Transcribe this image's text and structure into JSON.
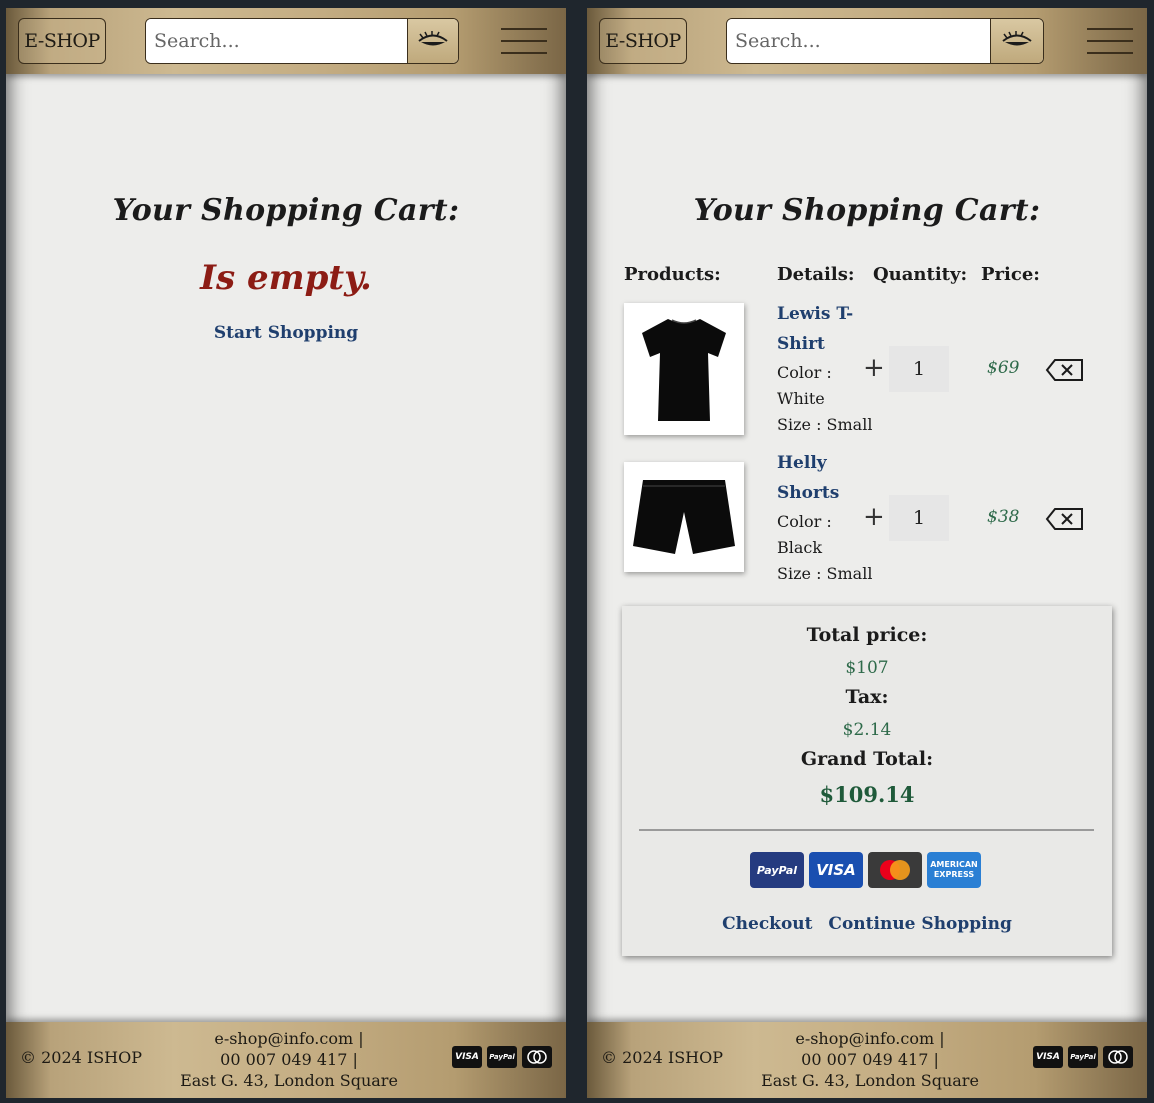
{
  "header": {
    "logo": "E-SHOP",
    "search_placeholder": "Search..."
  },
  "empty_view": {
    "title": "Your Shopping Cart:",
    "empty_text": "Is empty.",
    "start_link": "Start Shopping"
  },
  "cart_view": {
    "title": "Your Shopping Cart:",
    "columns": [
      "Products:",
      "Details:",
      "Quantity:",
      "Price:"
    ],
    "items": [
      {
        "name": "Lewis T-Shirt",
        "color_label": "Color :",
        "color": "White",
        "size_label": "Size :",
        "size": "Small",
        "quantity": "1",
        "price": "$69"
      },
      {
        "name": "Helly Shorts",
        "color_label": "Color :",
        "color": "Black",
        "size_label": "Size :",
        "size": "Small",
        "quantity": "1",
        "price": "$38"
      }
    ],
    "summary": {
      "total_label": "Total price:",
      "total": "$107",
      "tax_label": "Tax:",
      "tax": "$2.14",
      "grand_label": "Grand Total:",
      "grand_total": "$109.14"
    },
    "payment_methods": [
      "PayPal",
      "VISA",
      "Mastercard",
      "American Express"
    ],
    "checkout_link": "Checkout",
    "continue_link": "Continue Shopping"
  },
  "footer": {
    "copyright": "© 2024 ISHOP",
    "email": "e-shop@info.com |",
    "phone": "00 007 049 417 |",
    "address": "East G. 43, London Square",
    "cards": [
      "VISA",
      "PayPal",
      "Mastercard"
    ]
  },
  "colors": {
    "accent_red": "#8c1c14",
    "link_blue": "#1f3f6e",
    "price_green": "#2e6a4a",
    "gold": "#c4ad83"
  }
}
